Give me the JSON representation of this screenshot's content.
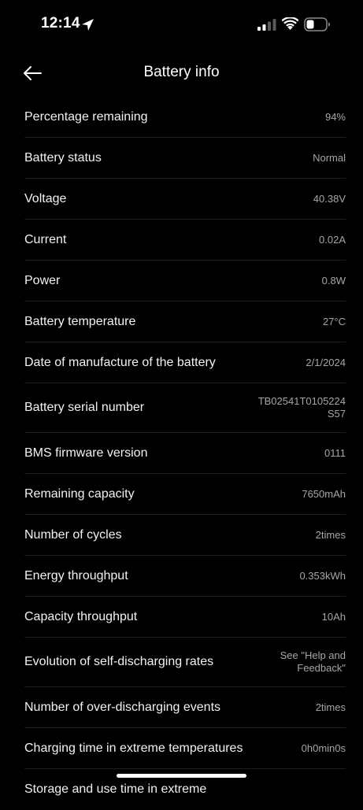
{
  "status_bar": {
    "time": "12:14",
    "icons": [
      "location-arrow-icon",
      "cellular-signal-icon",
      "wifi-icon",
      "battery-icon"
    ]
  },
  "nav": {
    "back_icon": "arrow-left-icon",
    "title": "Battery info"
  },
  "rows": [
    {
      "label": "Percentage remaining",
      "value": "94%"
    },
    {
      "label": "Battery status",
      "value": "Normal"
    },
    {
      "label": "Voltage",
      "value": "40.38V"
    },
    {
      "label": "Current",
      "value": "0.02A"
    },
    {
      "label": "Power",
      "value": "0.8W"
    },
    {
      "label": "Battery temperature",
      "value": "27°C"
    },
    {
      "label": "Date of manufacture of the battery",
      "value": "2/1/2024"
    },
    {
      "label": "Battery serial number",
      "value": "TB02541T0105224\nS57"
    },
    {
      "label": "BMS firmware version",
      "value": "0111"
    },
    {
      "label": "Remaining capacity",
      "value": "7650mAh"
    },
    {
      "label": "Number of cycles",
      "value": "2times"
    },
    {
      "label": "Energy throughput",
      "value": "0.353kWh"
    },
    {
      "label": "Capacity throughput",
      "value": "10Ah"
    },
    {
      "label": "Evolution of self-discharging rates",
      "value": "See \"Help and\nFeedback\""
    },
    {
      "label": "Number of over-discharging events",
      "value": "2times"
    },
    {
      "label": "Charging time in extreme temperatures",
      "value": "0h0min0s"
    },
    {
      "label": "Storage and use time in extreme",
      "value": ""
    }
  ],
  "colors": {
    "background": "#000000",
    "label_text": "#f2f2f2",
    "value_text": "#a6a6a6",
    "divider": "#1e1e1e"
  }
}
